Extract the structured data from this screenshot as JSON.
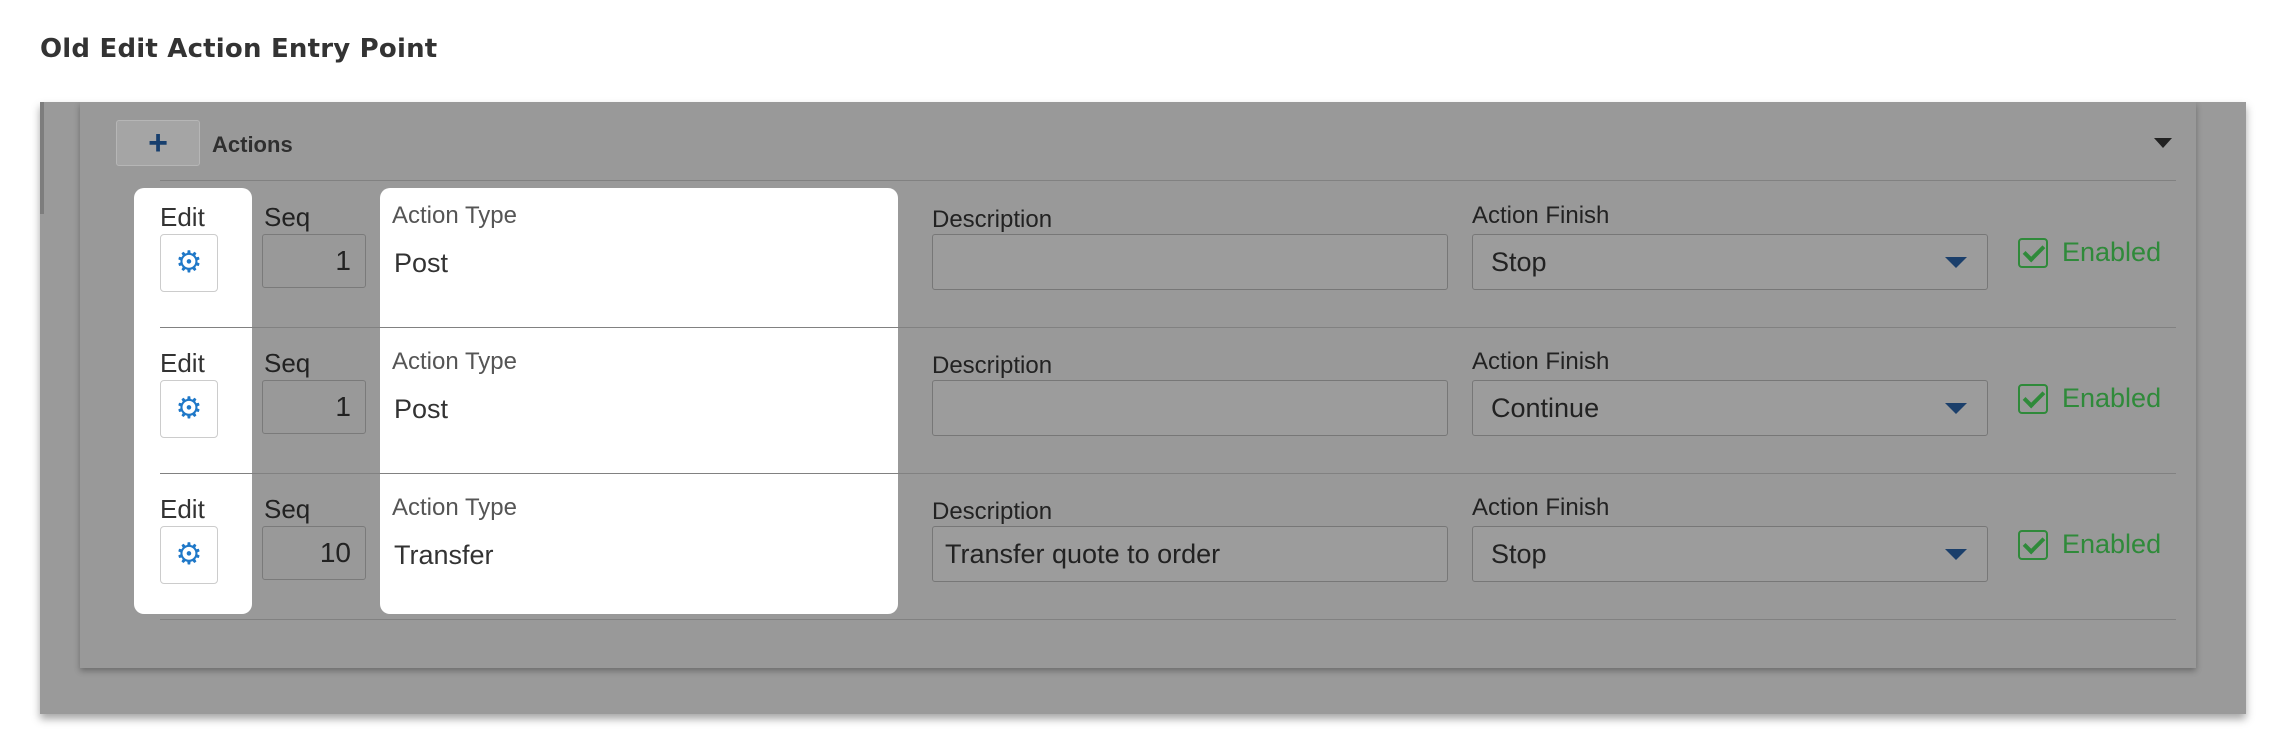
{
  "page_title": "Old Edit Action Entry Point",
  "actions_panel": {
    "add_icon": "plus-icon",
    "title": "Actions",
    "collapse_icon": "caret-down-icon"
  },
  "labels": {
    "edit": "Edit",
    "seq": "Seq",
    "action_type": "Action Type",
    "description": "Description",
    "action_finish": "Action Finish",
    "enabled": "Enabled"
  },
  "rows": [
    {
      "seq": "1",
      "action_type": "Post",
      "description": "",
      "action_finish": "Stop",
      "enabled": true
    },
    {
      "seq": "1",
      "action_type": "Post",
      "description": "",
      "action_finish": "Continue",
      "enabled": true
    },
    {
      "seq": "10",
      "action_type": "Transfer",
      "description": "Transfer quote to order",
      "action_finish": "Stop",
      "enabled": true
    }
  ],
  "colors": {
    "gear_blue": "#1f78c8",
    "enabled_green": "#2f8a3a",
    "overlay_gray": "#999999",
    "highlight_white": "#ffffff"
  }
}
